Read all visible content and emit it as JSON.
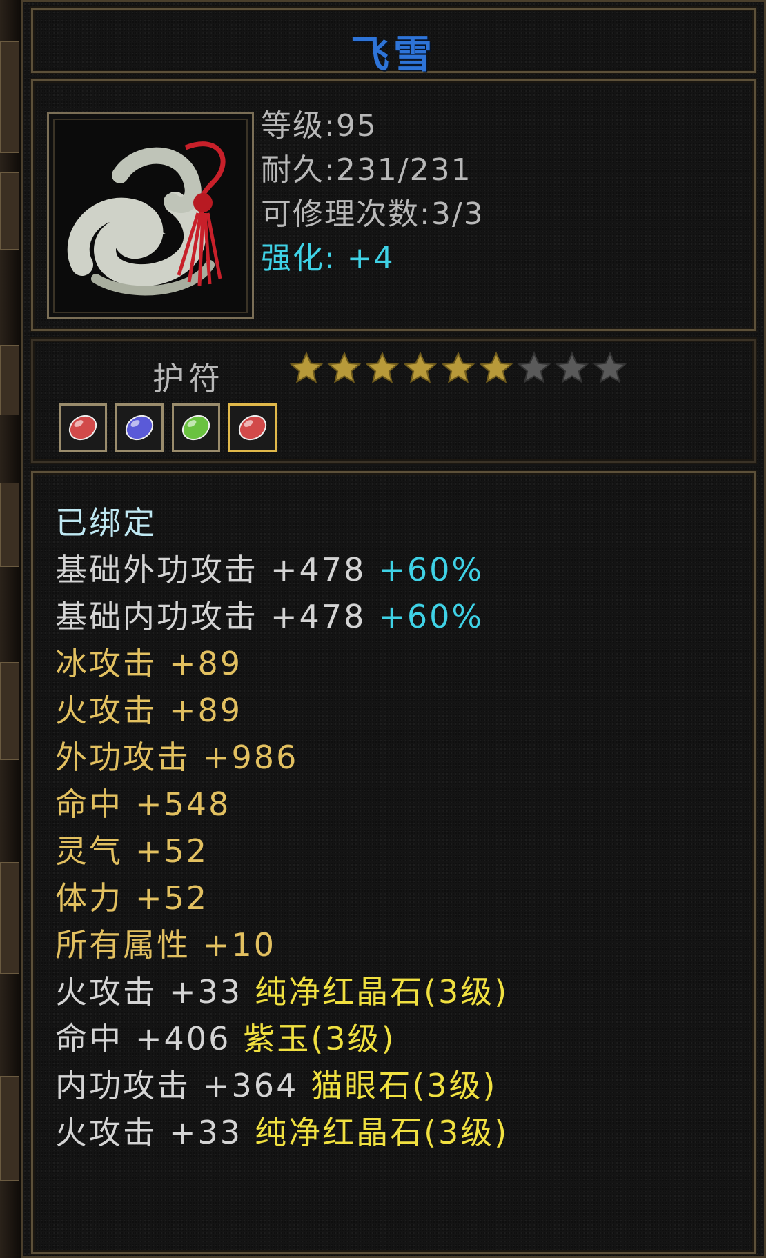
{
  "item": {
    "name": "飞雪",
    "name_color": "#2e74d8",
    "level": "等级:95",
    "durability": "耐久:231/231",
    "repair_count": "可修理次数:3/3",
    "enhance": "强化: +4",
    "enhance_color": "#3fd2e6"
  },
  "slot": {
    "type_label": "护符",
    "stars_filled": 6,
    "stars_total": 9,
    "gem_sockets": [
      {
        "gem": "red-crystal-gem-icon",
        "color": "#d24a4a"
      },
      {
        "gem": "purple-jade-gem-icon",
        "color": "#5a5ad8"
      },
      {
        "gem": "cats-eye-gem-icon",
        "color": "#6ac240"
      },
      {
        "gem": "red-crystal-gem-icon",
        "color": "#d24a4a"
      }
    ]
  },
  "attributes": {
    "bound": "已绑定",
    "base": [
      {
        "name": "基础外功攻击",
        "value": "+478",
        "bonus": "+60%"
      },
      {
        "name": "基础内功攻击",
        "value": "+478",
        "bonus": "+60%"
      }
    ],
    "extra": [
      {
        "name": "冰攻击",
        "value": "+89"
      },
      {
        "name": "火攻击",
        "value": "+89"
      },
      {
        "name": "外功攻击",
        "value": "+986"
      },
      {
        "name": "命中",
        "value": "+548"
      },
      {
        "name": "灵气",
        "value": "+52"
      },
      {
        "name": "体力",
        "value": "+52"
      },
      {
        "name": "所有属性",
        "value": "+10"
      }
    ],
    "gems": [
      {
        "name": "火攻击",
        "value": "+33",
        "gem": "纯净红晶石(3级)"
      },
      {
        "name": "命中",
        "value": "+406",
        "gem": "紫玉(3级)"
      },
      {
        "name": "内功攻击",
        "value": "+364",
        "gem": "猫眼石(3级)"
      },
      {
        "name": "火攻击",
        "value": "+33",
        "gem": "纯净红晶石(3级)"
      }
    ]
  }
}
